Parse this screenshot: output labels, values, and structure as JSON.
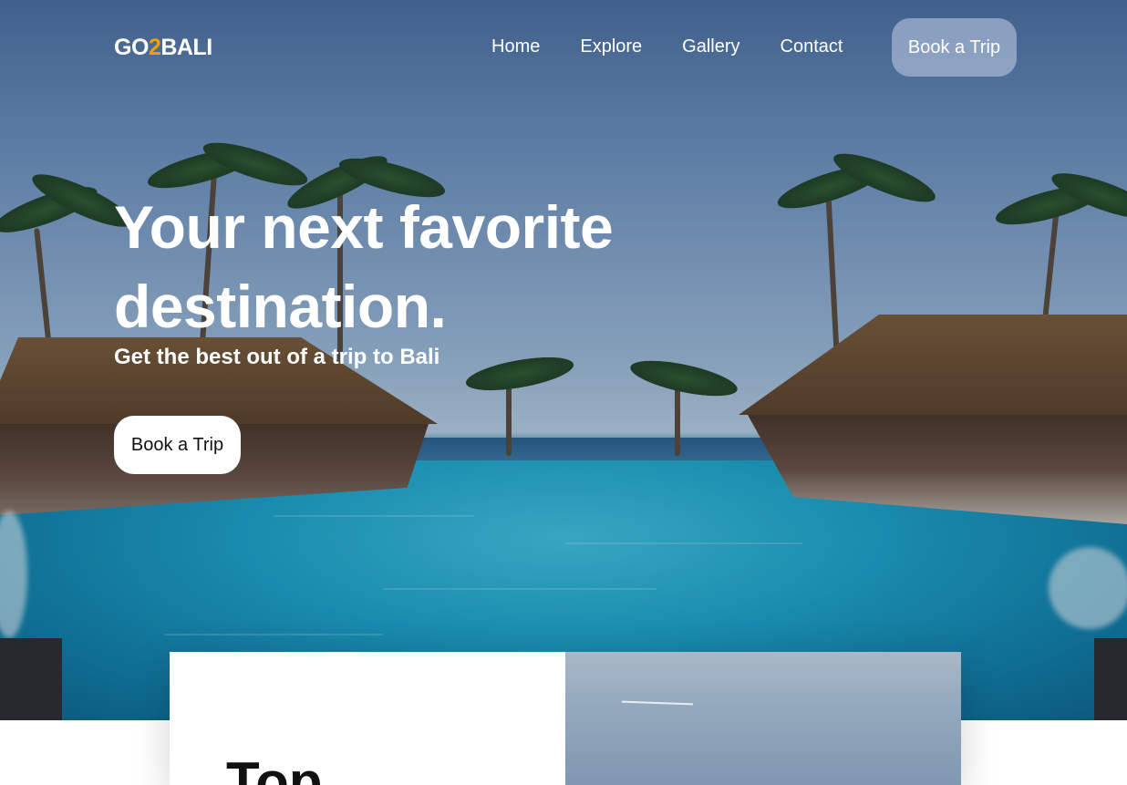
{
  "brand": {
    "logo_prefix": "GO",
    "logo_accent": "2",
    "logo_suffix": "BALI",
    "accent_color": "#f2a100"
  },
  "nav": {
    "links": [
      "Home",
      "Explore",
      "Gallery",
      "Contact"
    ],
    "cta": "Book a Trip"
  },
  "hero": {
    "title": "Your next favorite destination.",
    "subtitle": "Get the best out of a trip to Bali",
    "button": "Book a Trip"
  },
  "feature": {
    "title": "Top"
  }
}
